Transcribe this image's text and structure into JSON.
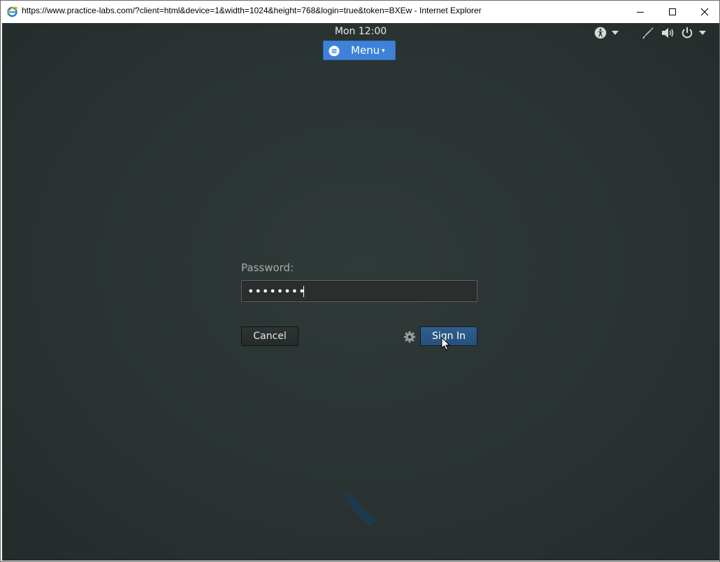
{
  "window": {
    "title": "https://www.practice-labs.com/?client=html&device=1&width=1024&height=768&login=true&token=BXEw - Internet Explorer",
    "app_icon": "internet-explorer-icon",
    "controls": {
      "minimize_icon": "minimize-icon",
      "maximize_icon": "maximize-icon",
      "close_icon": "close-icon"
    }
  },
  "top_bar": {
    "clock": "Mon 12:00",
    "menu": {
      "label": "Menu",
      "caret": "▾",
      "icon": "menu-list-icon"
    },
    "tray": {
      "accessibility_icon": "accessibility-icon",
      "pen_icon": "pen-icon",
      "volume_icon": "volume-icon",
      "power_icon": "power-icon"
    }
  },
  "login": {
    "password_label": "Password:",
    "password_value": "••••••••",
    "cancel_label": "Cancel",
    "signin_label": "Sign In",
    "settings_icon": "gear-icon"
  },
  "colors": {
    "desktop": "#2a3332",
    "menu_button": "#3d82d8",
    "signin_button": "#2a5783"
  }
}
